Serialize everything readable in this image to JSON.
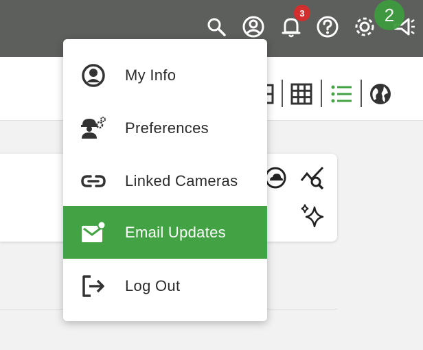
{
  "header": {
    "notification_count": "3",
    "step_badge": "2",
    "icons": [
      "search-icon",
      "account-icon",
      "bell-icon",
      "help-icon",
      "gear-icon",
      "announcement-icon"
    ]
  },
  "toolbar": {
    "icons": [
      "layout-icon",
      "grid-view-icon",
      "list-view-icon",
      "globe-icon"
    ],
    "active_color": "#43a344"
  },
  "card": {
    "icons": [
      "cloud-icon",
      "chart-search-icon",
      "sparkles-icon"
    ]
  },
  "menu": {
    "items": [
      {
        "label": "My Info",
        "icon": "account-circle-icon"
      },
      {
        "label": "Preferences",
        "icon": "worker-settings-icon"
      },
      {
        "label": "Linked Cameras",
        "icon": "link-icon"
      },
      {
        "label": "Email Updates",
        "icon": "email-notification-icon",
        "active": true
      },
      {
        "label": "Log Out",
        "icon": "logout-icon"
      }
    ],
    "accent": "#43a344"
  }
}
